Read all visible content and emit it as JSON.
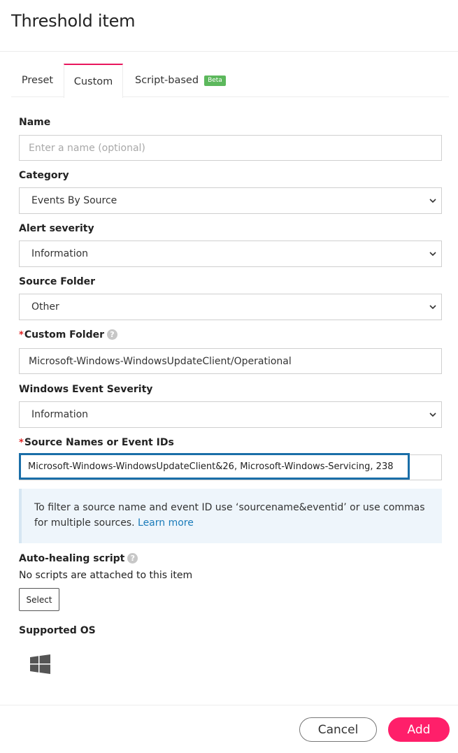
{
  "dialog": {
    "title": "Threshold item"
  },
  "tabs": [
    {
      "label": "Preset",
      "active": false
    },
    {
      "label": "Custom",
      "active": true
    },
    {
      "label": "Script-based",
      "active": false,
      "badge": "Beta"
    }
  ],
  "form": {
    "name": {
      "label": "Name",
      "placeholder": "Enter a name (optional)",
      "value": ""
    },
    "category": {
      "label": "Category",
      "value": "Events By Source"
    },
    "alert_severity": {
      "label": "Alert severity",
      "value": "Information"
    },
    "source_folder": {
      "label": "Source Folder",
      "value": "Other"
    },
    "custom_folder": {
      "label": "Custom Folder",
      "required_mark": "*",
      "value": "Microsoft-Windows-WindowsUpdateClient/Operational"
    },
    "windows_event_severity": {
      "label": "Windows Event Severity",
      "value": "Information"
    },
    "source_names": {
      "label": "Source Names or Event IDs",
      "required_mark": "*",
      "value": "Microsoft-Windows-WindowsUpdateClient&26, Microsoft-Windows-Servicing, 238"
    },
    "info_text": "To filter a source name and event ID use ‘sourcename&eventid’ or use commas for multiple sources.",
    "info_link": "Learn more",
    "auto_healing": {
      "label": "Auto-healing script",
      "status": "No scripts are attached to this item",
      "button": "Select"
    },
    "supported_os": {
      "label": "Supported OS",
      "icon": "windows-icon"
    }
  },
  "footer": {
    "cancel_label": "Cancel",
    "add_label": "Add"
  },
  "colors": {
    "accent": "#ff1f6a",
    "tab_indicator": "#e8175d",
    "highlight_border": "#1a6ea8",
    "link": "#1a7bb9",
    "beta_badge": "#5cb85c",
    "info_bg": "#eef5fb"
  }
}
